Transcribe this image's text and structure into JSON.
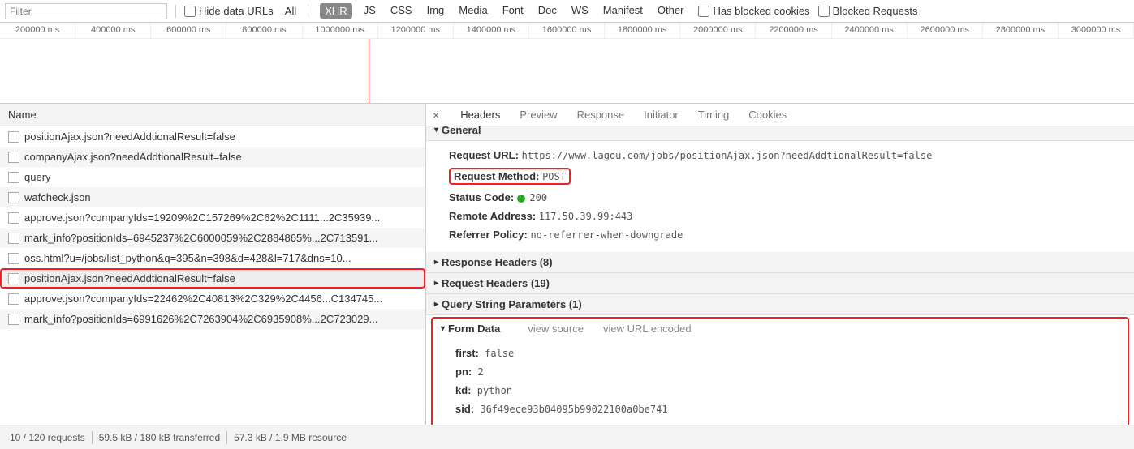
{
  "toolbar": {
    "filter_placeholder": "Filter",
    "hide_data_urls": "Hide data URLs",
    "all": "All",
    "types": [
      "XHR",
      "JS",
      "CSS",
      "Img",
      "Media",
      "Font",
      "Doc",
      "WS",
      "Manifest",
      "Other"
    ],
    "active_type_index": 0,
    "has_blocked_cookies": "Has blocked cookies",
    "blocked_requests": "Blocked Requests"
  },
  "timeline": {
    "ticks": [
      "200000 ms",
      "400000 ms",
      "600000 ms",
      "800000 ms",
      "1000000 ms",
      "1200000 ms",
      "1400000 ms",
      "1600000 ms",
      "1800000 ms",
      "2000000 ms",
      "2200000 ms",
      "2400000 ms",
      "2600000 ms",
      "2800000 ms",
      "3000000 ms"
    ]
  },
  "request_list": {
    "header": "Name",
    "selected_index": 7,
    "items": [
      "positionAjax.json?needAddtionalResult=false",
      "companyAjax.json?needAddtionalResult=false",
      "query",
      "wafcheck.json",
      "approve.json?companyIds=19209%2C157269%2C62%2C1111...2C35939...",
      "mark_info?positionIds=6945237%2C6000059%2C2884865%...2C713591...",
      "oss.html?u=/jobs/list_python&q=395&n=398&d=428&l=717&dns=10...",
      "positionAjax.json?needAddtionalResult=false",
      "approve.json?companyIds=22462%2C40813%2C329%2C4456...C134745...",
      "mark_info?positionIds=6991626%2C7263904%2C6935908%...2C723029..."
    ]
  },
  "detail_tabs": {
    "items": [
      "Headers",
      "Preview",
      "Response",
      "Initiator",
      "Timing",
      "Cookies"
    ],
    "active_index": 0
  },
  "general": {
    "title": "General",
    "request_url_label": "Request URL:",
    "request_url": "https://www.lagou.com/jobs/positionAjax.json?needAddtionalResult=false",
    "request_method_label": "Request Method:",
    "request_method": "POST",
    "status_code_label": "Status Code:",
    "status_code": "200",
    "remote_address_label": "Remote Address:",
    "remote_address": "117.50.39.99:443",
    "referrer_policy_label": "Referrer Policy:",
    "referrer_policy": "no-referrer-when-downgrade"
  },
  "sections": {
    "response_headers": "Response Headers (8)",
    "request_headers": "Request Headers (19)",
    "query_string": "Query String Parameters (1)"
  },
  "form_data": {
    "title": "Form Data",
    "view_source": "view source",
    "view_url_encoded": "view URL encoded",
    "fields": [
      {
        "k": "first:",
        "v": "false"
      },
      {
        "k": "pn:",
        "v": "2"
      },
      {
        "k": "kd:",
        "v": "python"
      },
      {
        "k": "sid:",
        "v": "36f49ece93b04095b99022100a0be741"
      }
    ]
  },
  "status_bar": {
    "requests": "10 / 120 requests",
    "transferred": "59.5 kB / 180 kB transferred",
    "resources": "57.3 kB / 1.9 MB resource"
  }
}
